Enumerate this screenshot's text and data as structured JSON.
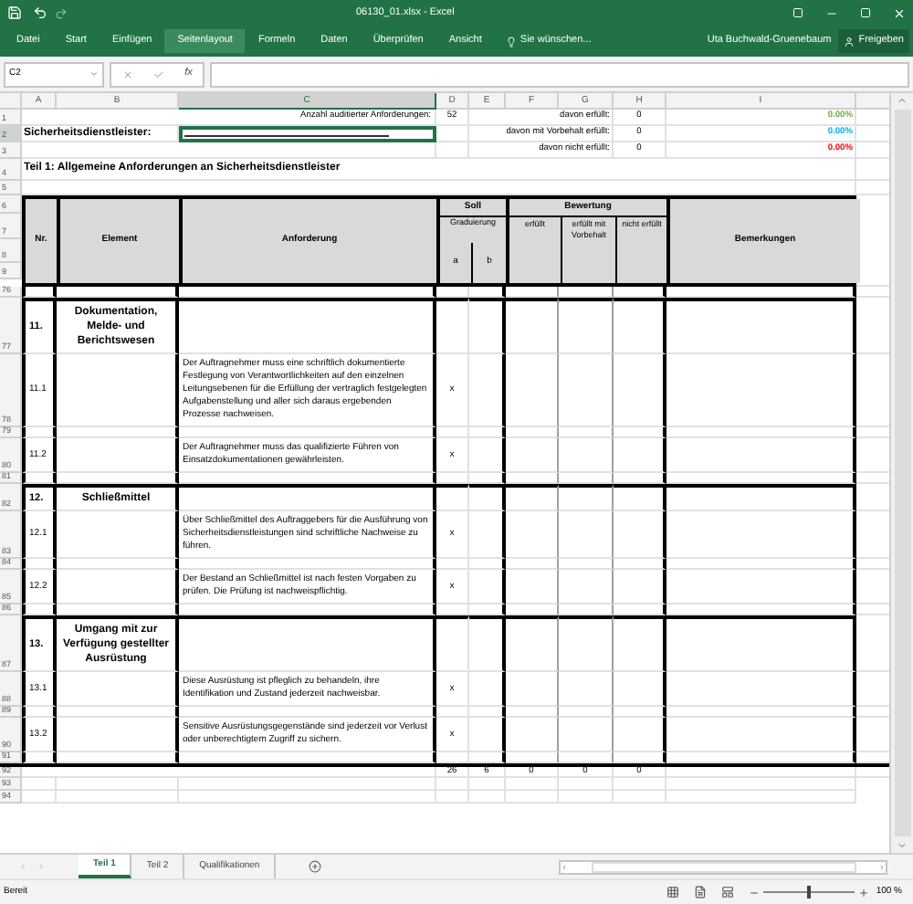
{
  "window": {
    "title": "06130_01.xlsx - Excel"
  },
  "ribbon_tabs": [
    {
      "label": "Datei",
      "selected": false
    },
    {
      "label": "Start",
      "selected": false
    },
    {
      "label": "Einfügen",
      "selected": false
    },
    {
      "label": "Seitenlayout",
      "selected": true
    },
    {
      "label": "Formeln",
      "selected": false
    },
    {
      "label": "Daten",
      "selected": false
    },
    {
      "label": "Überprüfen",
      "selected": false
    },
    {
      "label": "Ansicht",
      "selected": false
    }
  ],
  "tell_me": "Sie wünschen...",
  "user": "Uta Buchwald-Gruenebaum",
  "share_button": "Freigeben",
  "formula_bar": {
    "name_box": "C2",
    "fx": "fx"
  },
  "column_headers": [
    {
      "label": "A",
      "selected": false
    },
    {
      "label": "B",
      "selected": false
    },
    {
      "label": "C",
      "selected": true
    },
    {
      "label": "D",
      "selected": false
    },
    {
      "label": "E",
      "selected": false
    },
    {
      "label": "F",
      "selected": false
    },
    {
      "label": "G",
      "selected": false
    },
    {
      "label": "H",
      "selected": false
    },
    {
      "label": "I",
      "selected": false
    }
  ],
  "top": {
    "rows": [
      {
        "label": "1",
        "selected": false
      },
      {
        "label": "2",
        "selected": true
      },
      {
        "label": "3",
        "selected": false
      },
      {
        "label": "4",
        "selected": false
      },
      {
        "label": "5",
        "selected": false
      }
    ],
    "audit_label": "Anzahl auditierter Anforderungen:",
    "audit_count": "52",
    "provider_label": "Sicherheitsdienstleister:",
    "stats": [
      {
        "label": "davon erfüllt:",
        "value": "0",
        "percent": "0.00%",
        "color": "#70ad47"
      },
      {
        "label": "davon mit Vorbehalt erfüllt:",
        "value": "0",
        "percent": "0.00%",
        "color": "#00b0f0"
      },
      {
        "label": "davon nicht erfüllt:",
        "value": "0",
        "percent": "0.00%",
        "color": "#ff0000"
      }
    ],
    "part_title": "Teil 1: Allgemeine Anforderungen an Sicherheitsdienstleister"
  },
  "table_header": {
    "rows": [
      "6",
      "7",
      "8",
      "9"
    ],
    "nr": "Nr.",
    "element": "Element",
    "requirement": "Anforderung",
    "target": "Soll",
    "grading": "Graduierung",
    "a": "a",
    "b": "b",
    "rating": "Bewertung",
    "fulfilled": "erfüllt",
    "reserved": "erfüllt mit Vorbehalt",
    "not_fulfilled": "nicht erfüllt",
    "remarks": "Bemerkungen"
  },
  "body_rows": [
    {
      "row": "76",
      "kind": "spacer"
    },
    {
      "row": "77",
      "kind": "section",
      "nr": "11.",
      "element": "Dokumentation, Melde- und Berichtswesen"
    },
    {
      "row": "78",
      "kind": "item",
      "nr": "11.1",
      "text": "Der Auftragnehmer muss eine schriftlich dokumentierte Festlegung von Verantwortlichkeiten auf den einzelnen Leitungsebenen für die Erfüllung der vertraglich festgelegten Aufgabenstellung und aller sich daraus ergebenden Prozesse nachweisen.",
      "a": "x"
    },
    {
      "row": "79",
      "kind": "spacer"
    },
    {
      "row": "80",
      "kind": "item",
      "nr": "11.2",
      "text": "Der Auftragnehmer muss das qualifizierte Führen von Einsatzdokumentationen gewährleisten.",
      "a": "x"
    },
    {
      "row": "81",
      "kind": "spacer"
    },
    {
      "row": "82",
      "kind": "section",
      "nr": "12.",
      "element": "Schließmittel"
    },
    {
      "row": "83",
      "kind": "item",
      "nr": "12.1",
      "text": "Über Schließmittel des Auftraggebers für die Ausführung von Sicherheitsdienstleistungen sind schriftliche Nachweise zu führen.",
      "a": "x"
    },
    {
      "row": "84",
      "kind": "spacer"
    },
    {
      "row": "85",
      "kind": "item",
      "nr": "12.2",
      "text": "Der Bestand an Schließmittel ist nach festen Vorgaben zu prüfen. Die Prüfung ist nachweispflichtig.",
      "a": "x"
    },
    {
      "row": "86",
      "kind": "spacer"
    },
    {
      "row": "87",
      "kind": "section",
      "nr": "13.",
      "element": "Umgang mit zur Verfügung gestellter Ausrüstung"
    },
    {
      "row": "88",
      "kind": "item",
      "nr": "13.1",
      "text": "Diese Ausrüstung ist pfleglich zu behandeln, ihre Identifikation und Zustand  jederzeit nachweisbar.",
      "a": "x"
    },
    {
      "row": "89",
      "kind": "spacer"
    },
    {
      "row": "90",
      "kind": "item",
      "nr": "13.2",
      "text": "Sensitive Ausrüstungsgegenstände sind jederzeit vor Verlust oder unberechtigtem Zugriff zu sichern.",
      "a": "x"
    },
    {
      "row": "91",
      "kind": "spacer"
    }
  ],
  "total_row": {
    "row": "92",
    "values": [
      "26",
      "6",
      "0",
      "0",
      "0"
    ]
  },
  "trailing_rows": [
    "93",
    "94"
  ],
  "sheet_tabs": [
    {
      "label": "Teil 1",
      "selected": true
    },
    {
      "label": "Teil 2",
      "selected": false
    },
    {
      "label": "Qualifikationen",
      "selected": false
    }
  ],
  "status": {
    "text": "Bereit",
    "zoom": "100 %",
    "zoom_slider": {
      "level": 0.5
    }
  }
}
